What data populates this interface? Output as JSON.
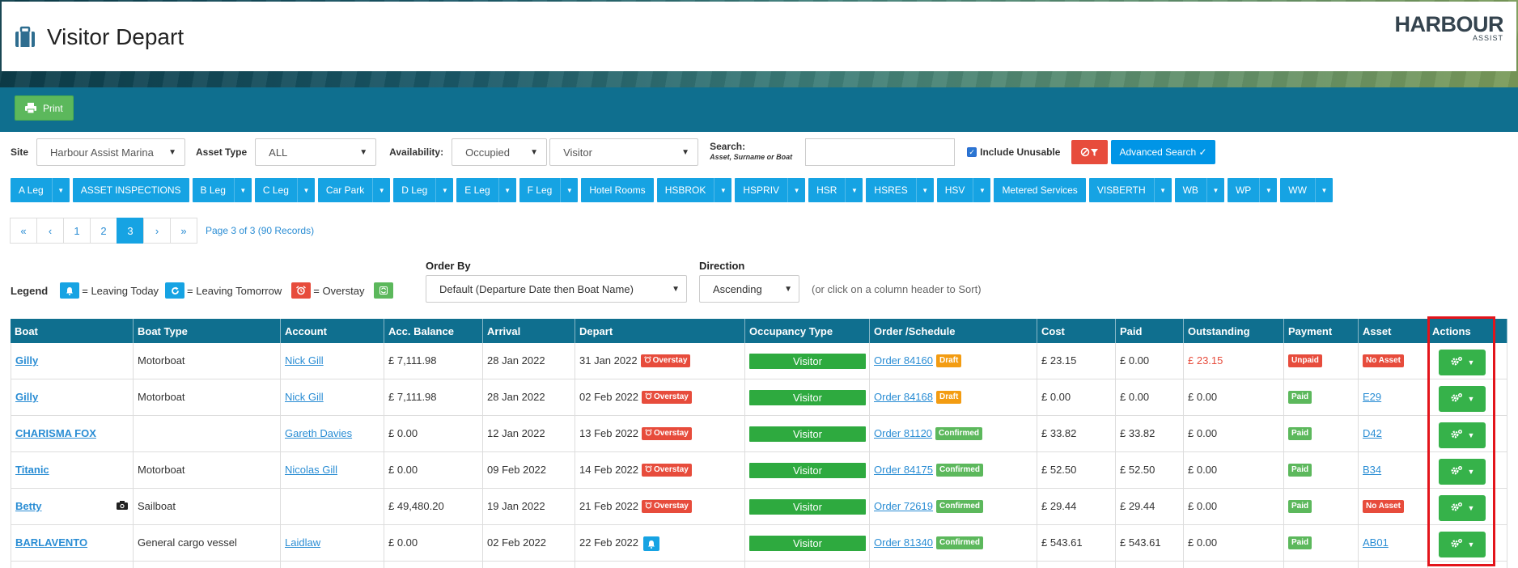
{
  "header": {
    "title": "Visitor Depart",
    "logo_main": "HARBOUR",
    "logo_sub": "ASSIST"
  },
  "toolbar": {
    "print_label": "Print"
  },
  "filters": {
    "site_label": "Site",
    "site_value": "Harbour Assist Marina",
    "asset_type_label": "Asset Type",
    "asset_type_value": "ALL",
    "availability_label": "Availability:",
    "availability_value": "Occupied",
    "occupancy_value": "Visitor",
    "search_label": "Search:",
    "search_sublabel": "Asset, Surname or Boat",
    "search_value": "",
    "include_unusable_label": "Include Unusable",
    "include_unusable_checked": true,
    "advanced_search_label": "Advanced Search ✓"
  },
  "legs": [
    {
      "label": "A Leg",
      "dropdown": true
    },
    {
      "label": "ASSET INSPECTIONS",
      "dropdown": false
    },
    {
      "label": "B Leg",
      "dropdown": true
    },
    {
      "label": "C Leg",
      "dropdown": true
    },
    {
      "label": "Car Park",
      "dropdown": true
    },
    {
      "label": "D Leg",
      "dropdown": true
    },
    {
      "label": "E Leg",
      "dropdown": true
    },
    {
      "label": "F Leg",
      "dropdown": true
    },
    {
      "label": "Hotel Rooms",
      "dropdown": false
    },
    {
      "label": "HSBROK",
      "dropdown": true
    },
    {
      "label": "HSPRIV",
      "dropdown": true
    },
    {
      "label": "HSR",
      "dropdown": true
    },
    {
      "label": "HSRES",
      "dropdown": true
    },
    {
      "label": "HSV",
      "dropdown": true
    },
    {
      "label": "Metered Services",
      "dropdown": false
    },
    {
      "label": "VISBERTH",
      "dropdown": true
    },
    {
      "label": "WB",
      "dropdown": true
    },
    {
      "label": "WP",
      "dropdown": true
    },
    {
      "label": "WW",
      "dropdown": true
    }
  ],
  "pagination": {
    "first": "«",
    "prev": "‹",
    "pages": [
      "1",
      "2",
      "3"
    ],
    "current": "3",
    "next": "›",
    "last": "»",
    "info": "Page 3 of 3 (90 Records)"
  },
  "legend": {
    "label": "Legend",
    "leaving_today": "= Leaving Today",
    "leaving_tomorrow": "= Leaving Tomorrow",
    "overstay": "= Overstay"
  },
  "ordering": {
    "order_by_label": "Order By",
    "order_by_value": "Default (Departure Date then Boat Name)",
    "direction_label": "Direction",
    "direction_value": "Ascending",
    "hint": "(or click on a column header to Sort)"
  },
  "table": {
    "columns": [
      "Boat",
      "Boat Type",
      "Account",
      "Acc. Balance",
      "Arrival",
      "Depart",
      "Occupancy Type",
      "Order /Schedule",
      "Cost",
      "Paid",
      "Outstanding",
      "Payment",
      "Asset",
      "Actions"
    ],
    "rows": [
      {
        "boat": "Gilly",
        "boat_type": "Motorboat",
        "account": "Nick Gill",
        "balance": "£ 7,111.98",
        "arrival": "28 Jan 2022",
        "depart": "31 Jan 2022",
        "depart_badge": "Overstay",
        "occupancy": "Visitor",
        "order": "Order 84160",
        "order_status": "Draft",
        "cost": "£ 23.15",
        "paid": "£ 0.00",
        "outstanding": "£ 23.15",
        "outstanding_red": true,
        "payment": "Unpaid",
        "asset": "No Asset",
        "camera": false
      },
      {
        "boat": "Gilly",
        "boat_type": "Motorboat",
        "account": "Nick Gill",
        "balance": "£ 7,111.98",
        "arrival": "28 Jan 2022",
        "depart": "02 Feb 2022",
        "depart_badge": "Overstay",
        "occupancy": "Visitor",
        "order": "Order 84168",
        "order_status": "Draft",
        "cost": "£ 0.00",
        "paid": "£ 0.00",
        "outstanding": "£ 0.00",
        "outstanding_red": false,
        "payment": "Paid",
        "asset": "E29",
        "camera": false
      },
      {
        "boat": "CHARISMA FOX",
        "boat_type": "",
        "account": "Gareth Davies",
        "balance": "£ 0.00",
        "arrival": "12 Jan 2022",
        "depart": "13 Feb 2022",
        "depart_badge": "Overstay",
        "occupancy": "Visitor",
        "order": "Order 81120",
        "order_status": "Confirmed",
        "cost": "£ 33.82",
        "paid": "£ 33.82",
        "outstanding": "£ 0.00",
        "outstanding_red": false,
        "payment": "Paid",
        "asset": "D42",
        "camera": false
      },
      {
        "boat": "Titanic",
        "boat_type": "Motorboat",
        "account": "Nicolas Gill",
        "balance": "£ 0.00",
        "arrival": "09 Feb 2022",
        "depart": "14 Feb 2022",
        "depart_badge": "Overstay",
        "occupancy": "Visitor",
        "order": "Order 84175",
        "order_status": "Confirmed",
        "cost": "£ 52.50",
        "paid": "£ 52.50",
        "outstanding": "£ 0.00",
        "outstanding_red": false,
        "payment": "Paid",
        "asset": "B34",
        "camera": false
      },
      {
        "boat": "Betty",
        "boat_type": "Sailboat",
        "account": "",
        "balance": "£ 49,480.20",
        "arrival": "19 Jan 2022",
        "depart": "21 Feb 2022",
        "depart_badge": "Overstay",
        "occupancy": "Visitor",
        "order": "Order 72619",
        "order_status": "Confirmed",
        "cost": "£ 29.44",
        "paid": "£ 29.44",
        "outstanding": "£ 0.00",
        "outstanding_red": false,
        "payment": "Paid",
        "asset": "No Asset",
        "camera": true
      },
      {
        "boat": "BARLAVENTO",
        "boat_type": "General cargo vessel",
        "account": "Laidlaw",
        "balance": "£ 0.00",
        "arrival": "02 Feb 2022",
        "depart": "22 Feb 2022",
        "depart_badge": "today",
        "occupancy": "Visitor",
        "order": "Order 81340",
        "order_status": "Confirmed",
        "cost": "£ 543.61",
        "paid": "£ 543.61",
        "outstanding": "£ 0.00",
        "outstanding_red": false,
        "payment": "Paid",
        "asset": "AB01",
        "camera": false
      }
    ]
  },
  "colors": {
    "primary": "#0f6f8f",
    "accent": "#16a3e3",
    "success": "#5cb85c",
    "danger": "#e74c3c",
    "warning": "#f39c12",
    "highlight": "#e3141b"
  }
}
